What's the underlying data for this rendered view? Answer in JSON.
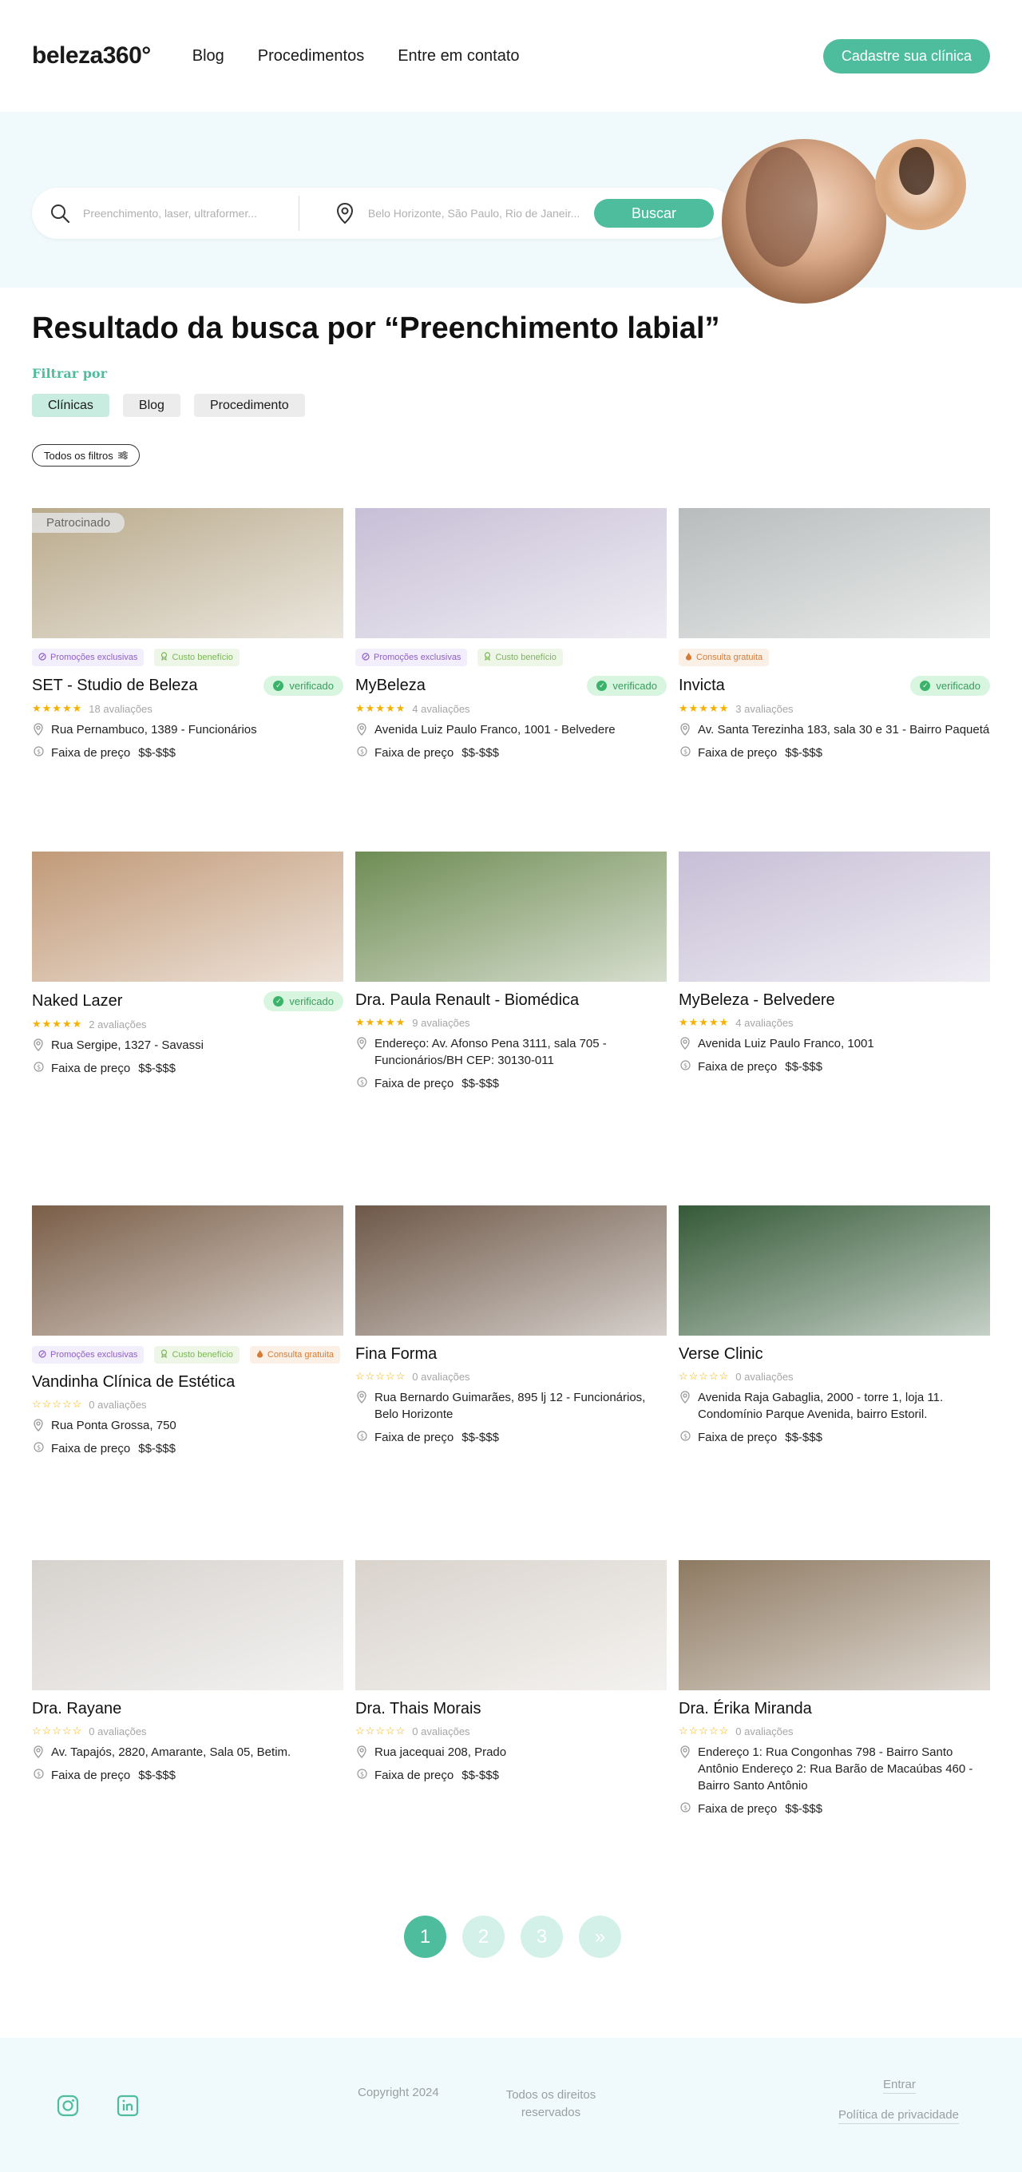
{
  "header": {
    "logo": "beleza360°",
    "nav": [
      "Blog",
      "Procedimentos",
      "Entre em contato"
    ],
    "cta": "Cadastre sua clínica"
  },
  "search": {
    "procedure_placeholder": "Preenchimento, laser, ultraformer...",
    "location_placeholder": "Belo Horizonte, São Paulo, Rio de Janeir...",
    "button": "Buscar"
  },
  "results": {
    "title": "Resultado da busca por “Preenchimento labial”",
    "filter_label": "Filtrar por",
    "filters": [
      "Clínicas",
      "Blog",
      "Procedimento"
    ],
    "all_filters": "Todos os filtros"
  },
  "labels": {
    "sponsored": "Patrocinado",
    "verified": "verificado",
    "price_label": "Faixa de preço",
    "promo": "Promoções exclusivas",
    "custo": "Custo benefício",
    "consulta": "Consulta gratuita"
  },
  "cards": [
    {
      "name": "SET - Studio de Beleza",
      "reviews": "18 avaliações",
      "rating": 5,
      "address": "Rua Pernambuco, 1389 - Funcionários",
      "price": "$$-$$$",
      "verified": true,
      "sponsored": true,
      "tags": [
        "promo",
        "custo"
      ]
    },
    {
      "name": "MyBeleza",
      "reviews": "4 avaliações",
      "rating": 5,
      "address": "Avenida Luiz Paulo Franco, 1001 - Belvedere",
      "price": "$$-$$$",
      "verified": true,
      "sponsored": false,
      "tags": [
        "promo",
        "custo"
      ]
    },
    {
      "name": "Invicta",
      "reviews": "3 avaliações",
      "rating": 5,
      "address": "Av. Santa Terezinha 183, sala 30 e 31 - Bairro Paquetá",
      "price": "$$-$$$",
      "verified": true,
      "sponsored": false,
      "tags": [
        "consulta"
      ]
    },
    {
      "name": "Naked Lazer",
      "reviews": "2 avaliações",
      "rating": 5,
      "address": "Rua Sergipe, 1327 - Savassi",
      "price": "$$-$$$",
      "verified": true,
      "sponsored": false,
      "tags": []
    },
    {
      "name": "Dra. Paula Renault - Biomédica",
      "reviews": "9 avaliações",
      "rating": 5,
      "address": "Endereço: Av. Afonso Pena 3111, sala 705 - Funcionários/BH CEP: 30130-011",
      "price": "$$-$$$",
      "verified": false,
      "sponsored": false,
      "tags": []
    },
    {
      "name": "MyBeleza - Belvedere",
      "reviews": "4 avaliações",
      "rating": 5,
      "address": "Avenida Luiz Paulo Franco, 1001",
      "price": "$$-$$$",
      "verified": false,
      "sponsored": false,
      "tags": []
    },
    {
      "name": "Vandinha Clínica de Estética",
      "reviews": "0 avaliações",
      "rating": 0,
      "address": "Rua Ponta Grossa, 750",
      "price": "$$-$$$",
      "verified": false,
      "sponsored": false,
      "tags": [
        "promo",
        "custo",
        "consulta"
      ]
    },
    {
      "name": "Fina Forma",
      "reviews": "0 avaliações",
      "rating": 0,
      "address": "Rua Bernardo Guimarães, 895 lj 12 - Funcionários, Belo Horizonte",
      "price": "$$-$$$",
      "verified": false,
      "sponsored": false,
      "tags": []
    },
    {
      "name": "Verse Clinic",
      "reviews": "0 avaliações",
      "rating": 0,
      "address": "Avenida Raja Gabaglia, 2000 - torre 1, loja 11. Condomínio Parque Avenida, bairro Estoril.",
      "price": "$$-$$$",
      "verified": false,
      "sponsored": false,
      "tags": []
    },
    {
      "name": "Dra. Rayane",
      "reviews": "0 avaliações",
      "rating": 0,
      "address": "Av. Tapajós, 2820, Amarante, Sala 05, Betim.",
      "price": "$$-$$$",
      "verified": false,
      "sponsored": false,
      "tags": []
    },
    {
      "name": "Dra. Thais Morais",
      "reviews": "0 avaliações",
      "rating": 0,
      "address": "Rua jacequai 208, Prado",
      "price": "$$-$$$",
      "verified": false,
      "sponsored": false,
      "tags": []
    },
    {
      "name": "Dra. Érika Miranda",
      "reviews": "0 avaliações",
      "rating": 0,
      "address": "Endereço 1: Rua Congonhas 798 - Bairro Santo Antônio Endereço 2: Rua Barão de Macaúbas 460 - Bairro Santo Antônio",
      "price": "$$-$$$",
      "verified": false,
      "sponsored": false,
      "tags": []
    }
  ],
  "photo_colors": [
    "#b9aa8c",
    "#c7bfd6",
    "#b8bcbc",
    "#c19a78",
    "#6f8c54",
    "#c7bfd6",
    "#7a5e48",
    "#6e5848",
    "#355a38",
    "#d6d2ce",
    "#d9d3cc",
    "#8e7a62"
  ],
  "pagination": [
    "1",
    "2",
    "3",
    "»"
  ],
  "footer": {
    "copyright": "Copyright 2024",
    "rights": "Todos os direitos reservados",
    "login": "Entrar",
    "privacy": "Política de privacidade"
  },
  "colors": {
    "accent": "#4dbd9e",
    "hero_bg": "#f0f9fb"
  }
}
